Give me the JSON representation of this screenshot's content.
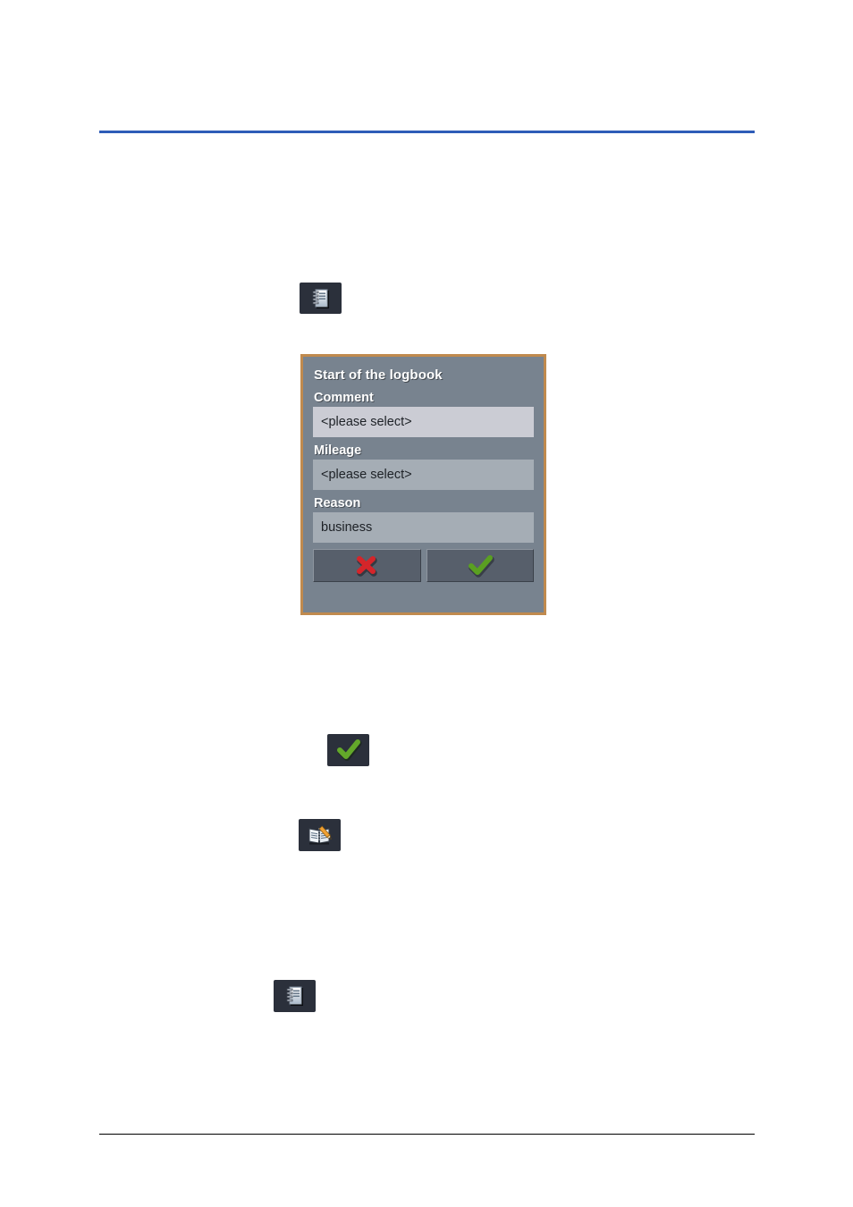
{
  "page": {
    "background_color": "#ffffff",
    "top_rule_color": "#2e5cb8",
    "bottom_rule_color": "#000000"
  },
  "icons": [
    {
      "id": "logbook-top",
      "name": "logbook-notebook-icon",
      "chip_color": "#2b303b"
    },
    {
      "id": "confirm",
      "name": "green-check-icon",
      "chip_color": "#2b303b"
    },
    {
      "id": "edit-logbook",
      "name": "logbook-edit-pencil-icon",
      "chip_color": "#2b303b"
    },
    {
      "id": "logbook-bottom",
      "name": "logbook-notebook-icon",
      "chip_color": "#2b303b"
    }
  ],
  "dialog": {
    "title": "Start of the logbook",
    "background_color": "#78838f",
    "border_color": "#c08a4e",
    "focused_field_color": "#cbccd4",
    "field_color": "#a5adb5",
    "fields": [
      {
        "label": "Comment",
        "value": "<please select>",
        "focused": true
      },
      {
        "label": "Mileage",
        "value": "<please select>",
        "focused": false
      },
      {
        "label": "Reason",
        "value": "business",
        "focused": false
      }
    ],
    "buttons": [
      {
        "name": "cancel-button",
        "icon": "red-cross-icon",
        "color": "#d4252a"
      },
      {
        "name": "confirm-button",
        "icon": "green-check-icon",
        "color": "#5aa021"
      }
    ]
  }
}
